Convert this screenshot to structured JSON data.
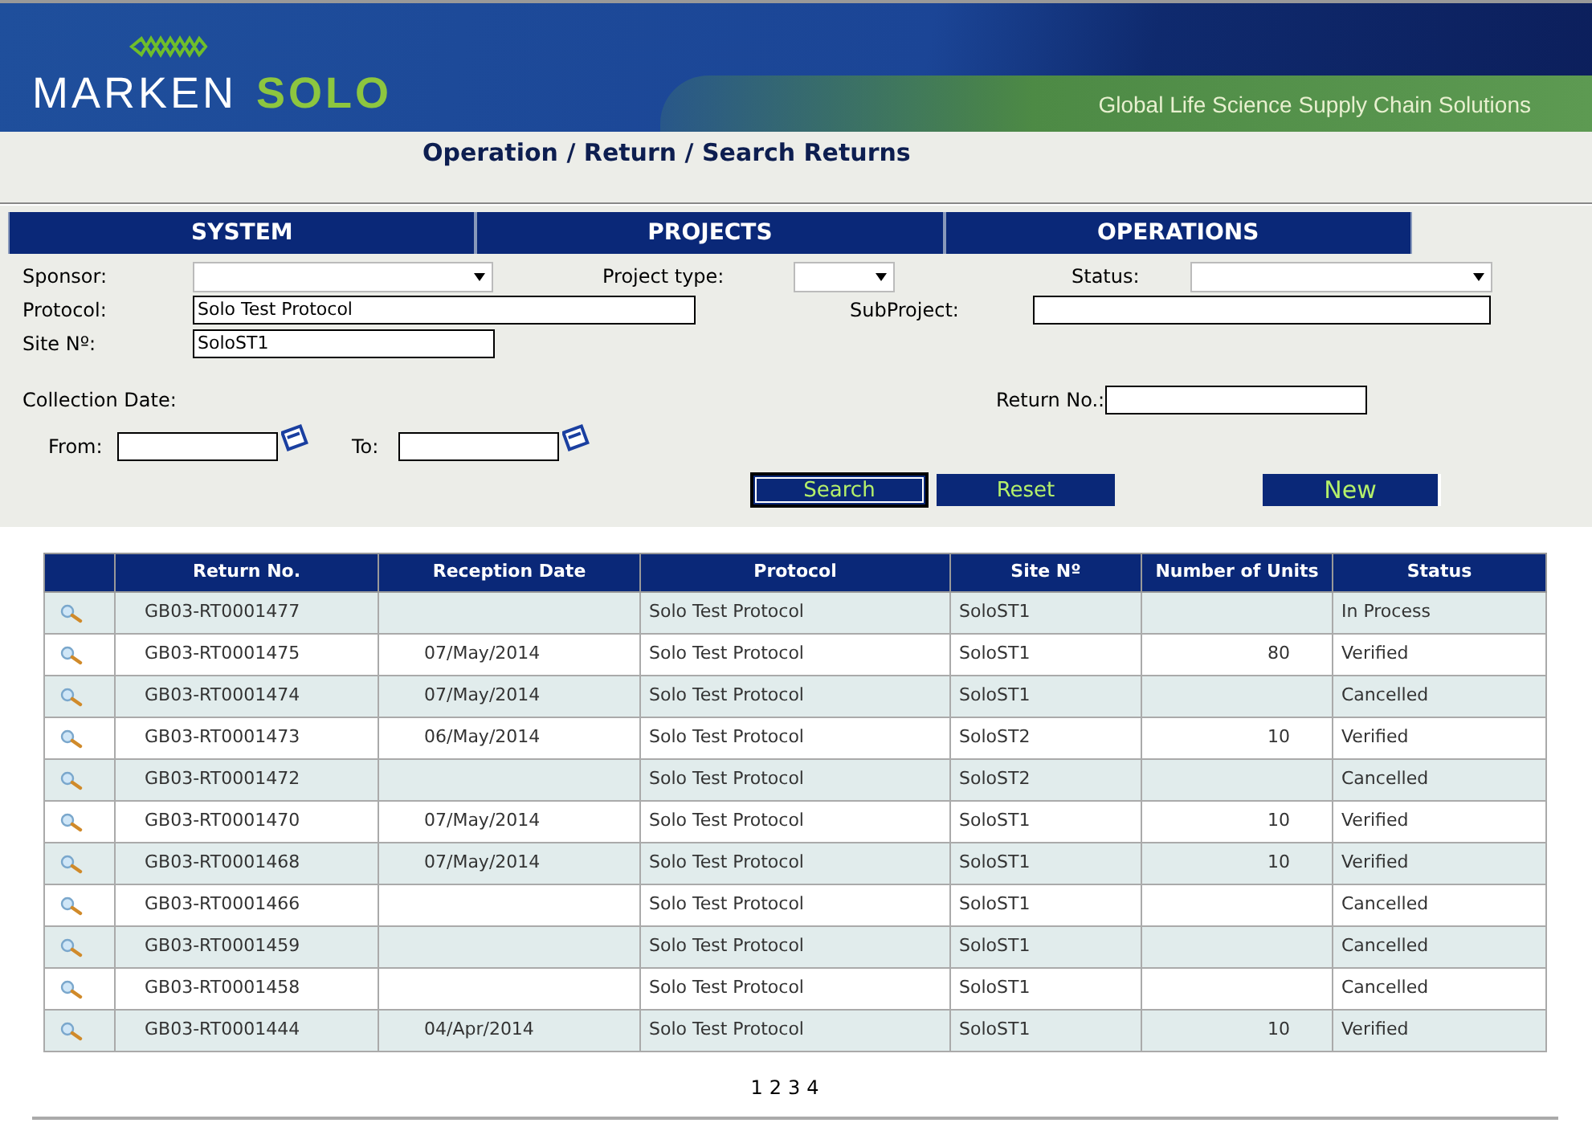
{
  "header": {
    "brand_1": "MARKEN",
    "brand_2": "SOLO",
    "tagline": "Global Life Science Supply Chain Solutions"
  },
  "breadcrumb": "Operation / Return / Search Returns",
  "menu": [
    "SYSTEM",
    "PROJECTS",
    "OPERATIONS"
  ],
  "filters": {
    "sponsor": {
      "label": "Sponsor:"
    },
    "project_type": {
      "label": "Project type:"
    },
    "status": {
      "label": "Status:"
    },
    "protocol": {
      "label": "Protocol:",
      "value": "Solo Test Protocol"
    },
    "subproject": {
      "label": "SubProject:"
    },
    "site": {
      "label": "Site Nº:",
      "value": "SoloST1"
    },
    "collection_date": "Collection Date:",
    "return_no": {
      "label": "Return No.:"
    },
    "from": {
      "label": "From:"
    },
    "to": {
      "label": "To:"
    }
  },
  "buttons": [
    "Search",
    "Reset",
    "New"
  ],
  "table": {
    "columns": [
      "Return No.",
      "Reception Date",
      "Protocol",
      "Site Nº",
      "Number of Units",
      "Status"
    ],
    "rows": [
      [
        "GB03-RT0001477",
        "",
        "Solo Test Protocol",
        "SoloST1",
        "",
        "In Process"
      ],
      [
        "GB03-RT0001475",
        "07/May/2014",
        "Solo Test Protocol",
        "SoloST1",
        "80",
        "Verified"
      ],
      [
        "GB03-RT0001474",
        "07/May/2014",
        "Solo Test Protocol",
        "SoloST1",
        "",
        "Cancelled"
      ],
      [
        "GB03-RT0001473",
        "06/May/2014",
        "Solo Test Protocol",
        "SoloST2",
        "10",
        "Verified"
      ],
      [
        "GB03-RT0001472",
        "",
        "Solo Test Protocol",
        "SoloST2",
        "",
        "Cancelled"
      ],
      [
        "GB03-RT0001470",
        "07/May/2014",
        "Solo Test Protocol",
        "SoloST1",
        "10",
        "Verified"
      ],
      [
        "GB03-RT0001468",
        "07/May/2014",
        "Solo Test Protocol",
        "SoloST1",
        "10",
        "Verified"
      ],
      [
        "GB03-RT0001466",
        "",
        "Solo Test Protocol",
        "SoloST1",
        "",
        "Cancelled"
      ],
      [
        "GB03-RT0001459",
        "",
        "Solo Test Protocol",
        "SoloST1",
        "",
        "Cancelled"
      ],
      [
        "GB03-RT0001458",
        "",
        "Solo Test Protocol",
        "SoloST1",
        "",
        "Cancelled"
      ],
      [
        "GB03-RT0001444",
        "04/Apr/2014",
        "Solo Test Protocol",
        "SoloST1",
        "10",
        "Verified"
      ]
    ]
  },
  "pages": [
    "1",
    "2",
    "3",
    "4"
  ]
}
